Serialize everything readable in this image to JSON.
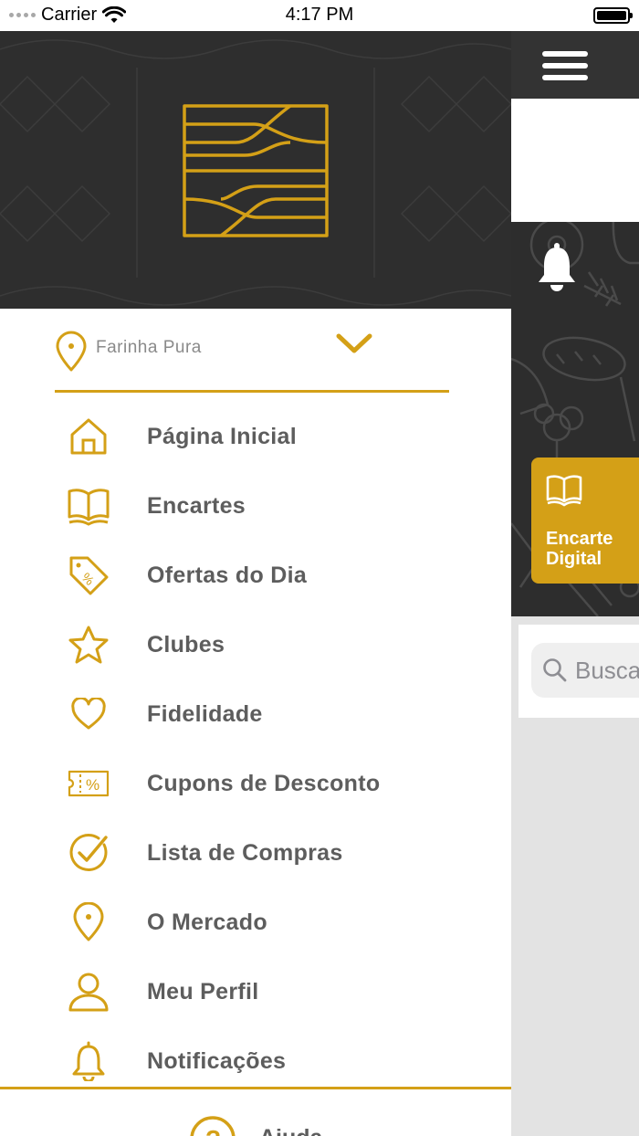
{
  "status_bar": {
    "carrier": "Carrier",
    "time": "4:17 PM",
    "icons": [
      "signal-icon",
      "wifi-icon",
      "battery-icon"
    ]
  },
  "store_selector": {
    "selected_store": "Farinha Pura",
    "icons": [
      "location-pin-icon",
      "chevron-down-icon"
    ]
  },
  "menu": {
    "items": [
      {
        "label": "Página Inicial",
        "icon": "home-icon"
      },
      {
        "label": "Encartes",
        "icon": "book-icon"
      },
      {
        "label": "Ofertas do Dia",
        "icon": "discount-tag-icon"
      },
      {
        "label": "Clubes",
        "icon": "star-icon"
      },
      {
        "label": "Fidelidade",
        "icon": "heart-icon"
      },
      {
        "label": "Cupons de Desconto",
        "icon": "coupon-icon"
      },
      {
        "label": "Lista de Compras",
        "icon": "check-circle-icon"
      },
      {
        "label": "O Mercado",
        "icon": "location-pin-icon"
      },
      {
        "label": "Meu Perfil",
        "icon": "user-icon"
      },
      {
        "label": "Notificações",
        "icon": "bell-icon"
      }
    ]
  },
  "footer": {
    "help_label": "Ajuda",
    "icon": "help-icon"
  },
  "background_app": {
    "encarte_label": "Encarte Digital",
    "search_placeholder": "Busca",
    "icons": [
      "menu-icon",
      "bell-icon",
      "book-icon",
      "search-icon"
    ]
  },
  "colors": {
    "accent": "#d4a017",
    "header_dark": "#2e2e2e",
    "menu_text": "#5d5d5d",
    "muted_text": "#8a8a8a"
  }
}
